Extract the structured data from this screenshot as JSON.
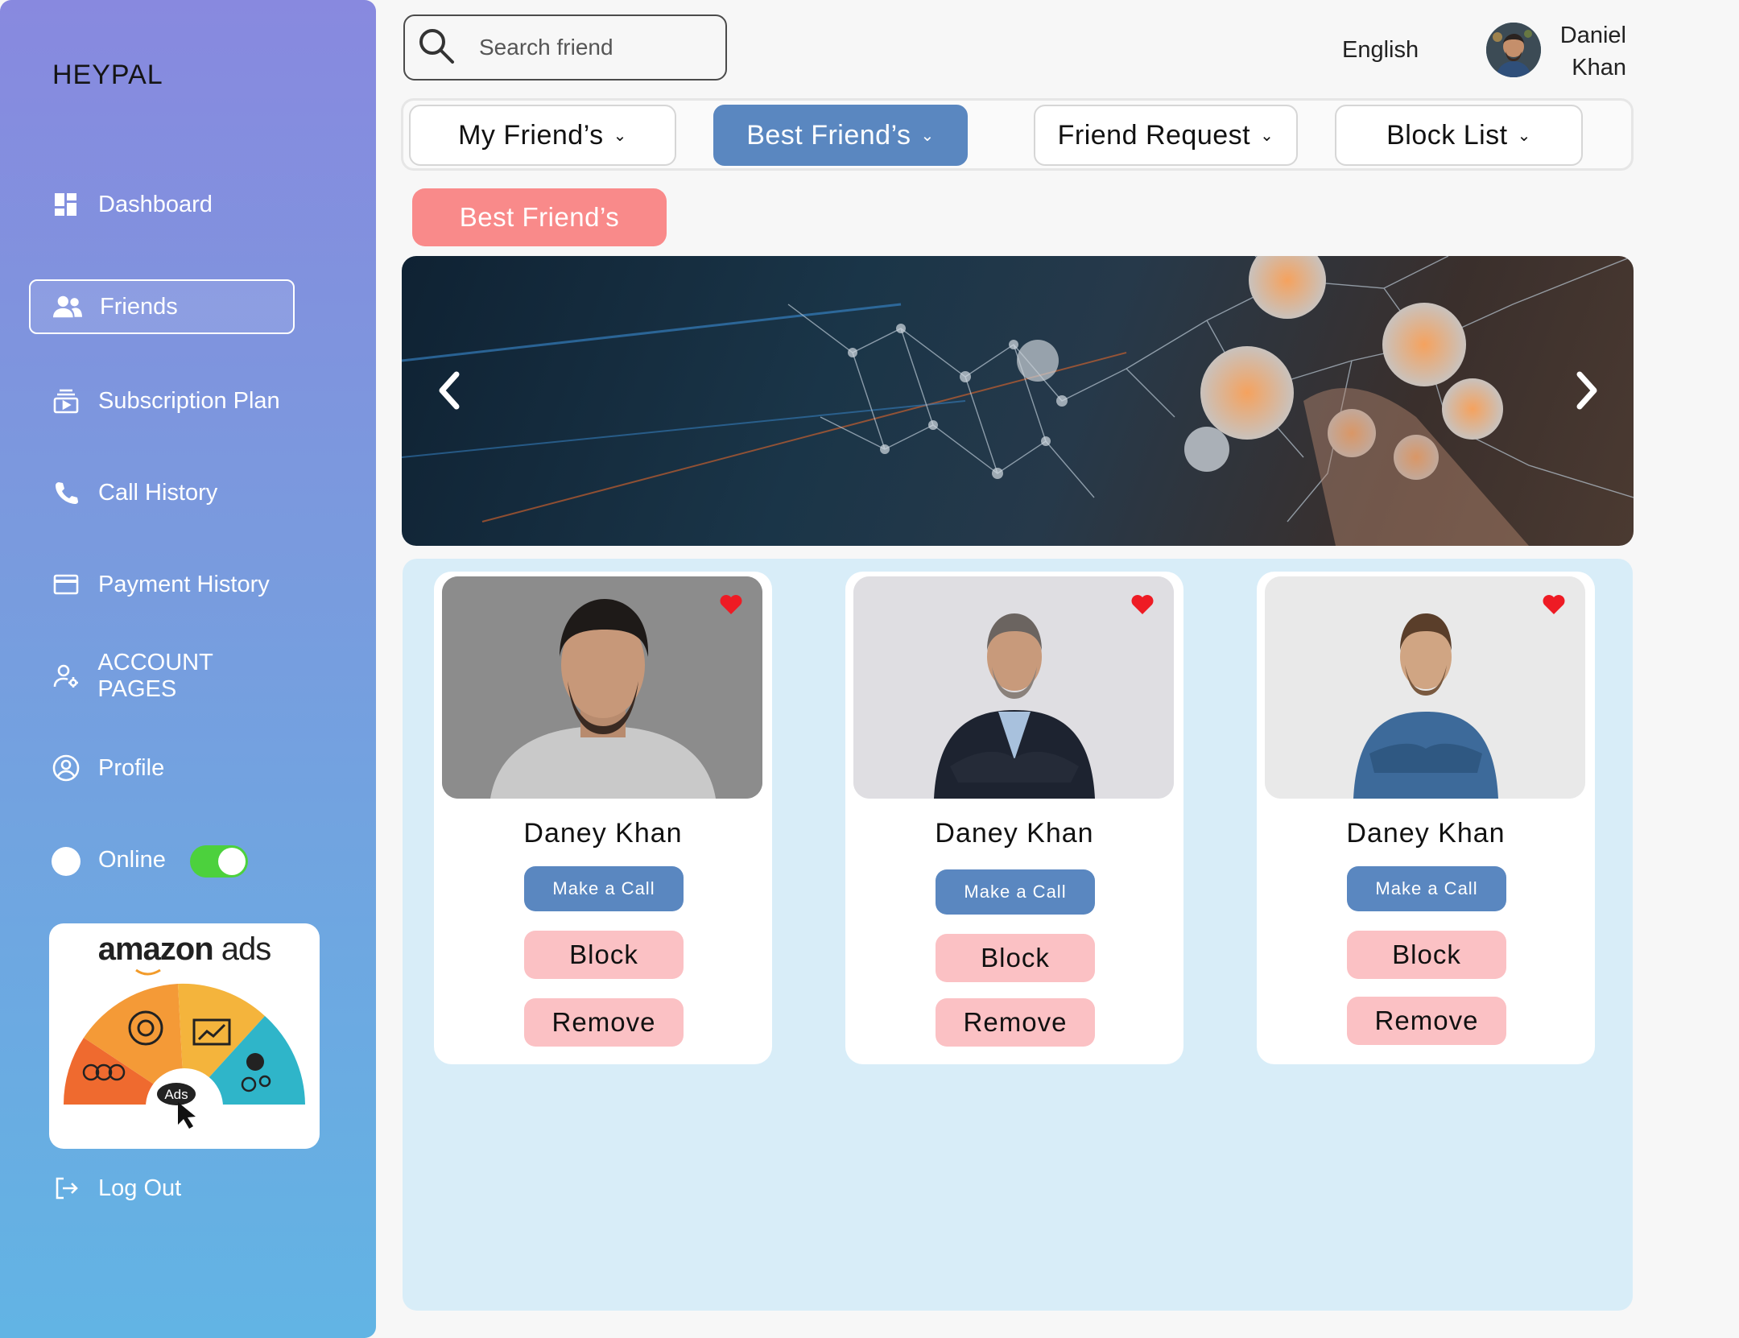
{
  "app": {
    "brand": "HEYPAL"
  },
  "sidebar": {
    "items": [
      {
        "label": "Dashboard",
        "icon": "dashboard-icon"
      },
      {
        "label": "Friends",
        "icon": "users-icon",
        "active": true
      },
      {
        "label": "Subscription Plan",
        "icon": "subscription-icon"
      },
      {
        "label": "Call History",
        "icon": "phone-icon"
      },
      {
        "label": "Payment History",
        "icon": "credit-card-icon"
      },
      {
        "label": "ACCOUNT PAGES",
        "icon": "account-icon"
      },
      {
        "label": "Profile",
        "icon": "profile-icon"
      }
    ],
    "status": {
      "label": "Online",
      "enabled": true
    },
    "ad": {
      "brand_bold": "amazon",
      "brand_light": "ads",
      "badge": "Ads"
    },
    "logout": {
      "label": "Log Out",
      "icon": "logout-icon"
    }
  },
  "header": {
    "search": {
      "placeholder": "Search friend",
      "value": ""
    },
    "language": "English",
    "user": {
      "first_name": "Daniel",
      "last_name": "Khan"
    }
  },
  "tabs": [
    {
      "label": "My Friend’s",
      "active": false
    },
    {
      "label": "Best Friend’s",
      "active": true
    },
    {
      "label": "Friend Request",
      "active": false
    },
    {
      "label": "Block List",
      "active": false
    }
  ],
  "section_label": "Best Friend’s",
  "friends": [
    {
      "name": "Daney Khan",
      "call": "Make a Call",
      "block": "Block",
      "remove": "Remove",
      "favorite": true
    },
    {
      "name": "Daney Khan",
      "call": "Make a Call",
      "block": "Block",
      "remove": "Remove",
      "favorite": true
    },
    {
      "name": "Daney Khan",
      "call": "Make a Call",
      "block": "Block",
      "remove": "Remove",
      "favorite": true
    }
  ],
  "colors": {
    "accent_blue": "#5a87c0",
    "accent_pink": "#f98a8a",
    "button_pink": "#fbc1c4",
    "toggle_green": "#4cd13d",
    "heart_red": "#ee1b24",
    "cards_bg": "#d8edf8"
  }
}
